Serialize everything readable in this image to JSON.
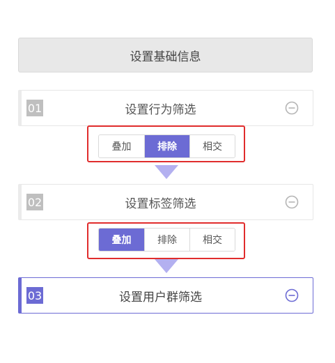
{
  "header": {
    "label": "设置基础信息"
  },
  "steps": [
    {
      "number": "01",
      "title": "设置行为筛选",
      "options": [
        "叠加",
        "排除",
        "相交"
      ],
      "selected": "排除"
    },
    {
      "number": "02",
      "title": "设置标签筛选",
      "options": [
        "叠加",
        "排除",
        "相交"
      ],
      "selected": "叠加"
    },
    {
      "number": "03",
      "title": "设置用户群筛选"
    }
  ],
  "colors": {
    "accent": "#6c6bd4",
    "arrow": "#b3b0f0",
    "highlight": "#e02c2c",
    "inactive_number_bg": "#bfbfbf"
  },
  "icons": {
    "collapse": "minus-circle-icon",
    "flow": "arrow-down-icon"
  }
}
